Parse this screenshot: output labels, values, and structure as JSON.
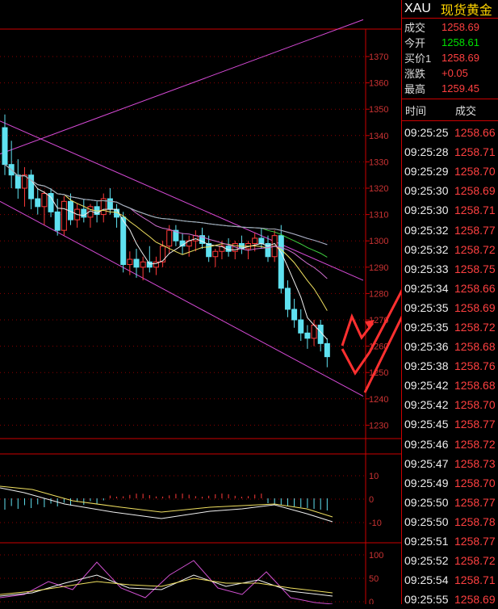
{
  "header": {
    "symbol": "XAU",
    "name": "现货黄金"
  },
  "quote": [
    {
      "label": "成交",
      "value": "1258.69",
      "color": "#ff4040"
    },
    {
      "label": "今开",
      "value": "1258.61",
      "color": "#00e000"
    },
    {
      "label": "买价1",
      "value": "1258.69",
      "color": "#ff4040"
    },
    {
      "label": "涨跌",
      "value": "+0.05",
      "color": "#ff4040"
    },
    {
      "label": "最高",
      "value": "1259.45",
      "color": "#ff4040"
    }
  ],
  "ticks_header": {
    "time": "时间",
    "price": "成交"
  },
  "ticks": [
    {
      "time": "09:25:25",
      "price": "1258.66"
    },
    {
      "time": "09:25:28",
      "price": "1258.71"
    },
    {
      "time": "09:25:29",
      "price": "1258.70"
    },
    {
      "time": "09:25:30",
      "price": "1258.69"
    },
    {
      "time": "09:25:30",
      "price": "1258.71"
    },
    {
      "time": "09:25:32",
      "price": "1258.77"
    },
    {
      "time": "09:25:32",
      "price": "1258.72"
    },
    {
      "time": "09:25:33",
      "price": "1258.75"
    },
    {
      "time": "09:25:34",
      "price": "1258.66"
    },
    {
      "time": "09:25:35",
      "price": "1258.69"
    },
    {
      "time": "09:25:35",
      "price": "1258.72"
    },
    {
      "time": "09:25:36",
      "price": "1258.68"
    },
    {
      "time": "09:25:38",
      "price": "1258.76"
    },
    {
      "time": "09:25:42",
      "price": "1258.68"
    },
    {
      "time": "09:25:42",
      "price": "1258.70"
    },
    {
      "time": "09:25:45",
      "price": "1258.77"
    },
    {
      "time": "09:25:46",
      "price": "1258.72"
    },
    {
      "time": "09:25:47",
      "price": "1258.73"
    },
    {
      "time": "09:25:49",
      "price": "1258.70"
    },
    {
      "time": "09:25:50",
      "price": "1258.77"
    },
    {
      "time": "09:25:50",
      "price": "1258.78"
    },
    {
      "time": "09:25:51",
      "price": "1258.77"
    },
    {
      "time": "09:25:52",
      "price": "1258.72"
    },
    {
      "time": "09:25:54",
      "price": "1258.71"
    },
    {
      "time": "09:25:55",
      "price": "1258.69"
    }
  ],
  "main_axis": {
    "labels": [
      "1370",
      "1360",
      "1350",
      "1340",
      "1330",
      "1320",
      "1310",
      "1300",
      "1290",
      "1280",
      "1270",
      "1260",
      "1250",
      "1240",
      "1230"
    ]
  },
  "macd_axis": {
    "labels": [
      "10",
      "0",
      "-10"
    ]
  },
  "kdj_axis": {
    "labels": [
      "100",
      "50",
      "0"
    ]
  },
  "chart_data": {
    "type": "candlestick",
    "ylim": [
      1225,
      1378
    ],
    "candles": [
      [
        1343,
        1348,
        1325,
        1329
      ],
      [
        1329,
        1338,
        1320,
        1325
      ],
      [
        1325,
        1331,
        1316,
        1320
      ],
      [
        1320,
        1328,
        1313,
        1325
      ],
      [
        1325,
        1327,
        1312,
        1316
      ],
      [
        1316,
        1320,
        1310,
        1313
      ],
      [
        1313,
        1319,
        1306,
        1318
      ],
      [
        1318,
        1320,
        1309,
        1311
      ],
      [
        1311,
        1316,
        1302,
        1304
      ],
      [
        1304,
        1317,
        1302,
        1315
      ],
      [
        1315,
        1318,
        1306,
        1308
      ],
      [
        1308,
        1314,
        1305,
        1312
      ],
      [
        1312,
        1316,
        1307,
        1309
      ],
      [
        1309,
        1314,
        1305,
        1313
      ],
      [
        1313,
        1315,
        1307,
        1310
      ],
      [
        1310,
        1318,
        1307,
        1316
      ],
      [
        1316,
        1320,
        1310,
        1312
      ],
      [
        1312,
        1314,
        1305,
        1309
      ],
      [
        1309,
        1311,
        1288,
        1291
      ],
      [
        1291,
        1296,
        1287,
        1293
      ],
      [
        1293,
        1297,
        1286,
        1290
      ],
      [
        1290,
        1294,
        1285,
        1292
      ],
      [
        1292,
        1298,
        1288,
        1290
      ],
      [
        1290,
        1294,
        1287,
        1292
      ],
      [
        1292,
        1300,
        1290,
        1298
      ],
      [
        1298,
        1306,
        1295,
        1304
      ],
      [
        1304,
        1306,
        1298,
        1300
      ],
      [
        1300,
        1303,
        1295,
        1298
      ],
      [
        1298,
        1302,
        1294,
        1300
      ],
      [
        1300,
        1304,
        1296,
        1302
      ],
      [
        1302,
        1305,
        1297,
        1299
      ],
      [
        1299,
        1302,
        1292,
        1294
      ],
      [
        1294,
        1297,
        1290,
        1296
      ],
      [
        1296,
        1300,
        1293,
        1298
      ],
      [
        1298,
        1301,
        1294,
        1296
      ],
      [
        1296,
        1300,
        1293,
        1299
      ],
      [
        1299,
        1302,
        1295,
        1297
      ],
      [
        1297,
        1300,
        1293,
        1299
      ],
      [
        1299,
        1303,
        1296,
        1301
      ],
      [
        1301,
        1305,
        1297,
        1299
      ],
      [
        1299,
        1302,
        1292,
        1294
      ],
      [
        1294,
        1304,
        1292,
        1302
      ],
      [
        1302,
        1306,
        1280,
        1282
      ],
      [
        1282,
        1285,
        1271,
        1274
      ],
      [
        1274,
        1278,
        1267,
        1270
      ],
      [
        1270,
        1274,
        1262,
        1265
      ],
      [
        1265,
        1268,
        1259,
        1263
      ],
      [
        1263,
        1270,
        1260,
        1268
      ],
      [
        1268,
        1270,
        1258,
        1261
      ],
      [
        1261,
        1263,
        1252,
        1256
      ]
    ]
  }
}
